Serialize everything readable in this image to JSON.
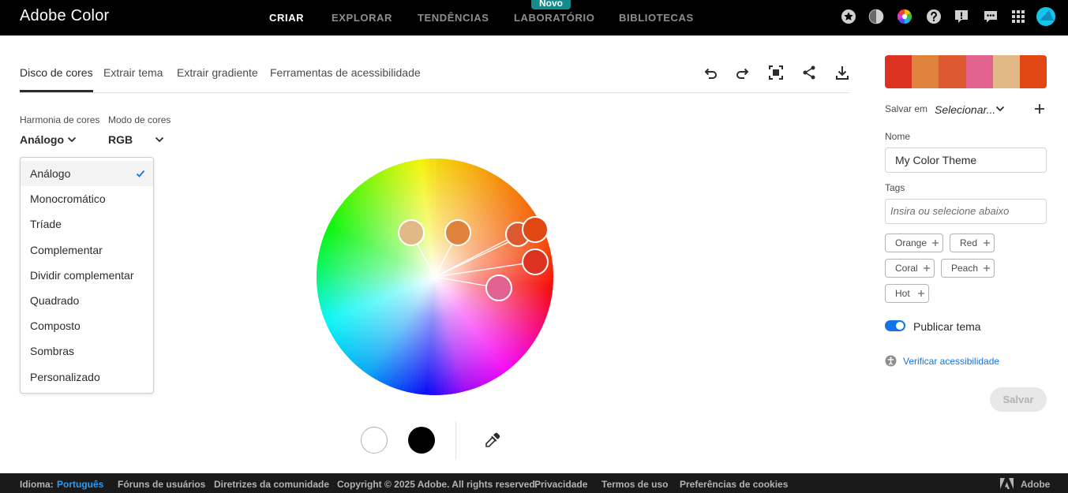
{
  "app": {
    "title": "Adobe Color"
  },
  "nav": {
    "items": [
      "CRIAR",
      "EXPLORAR",
      "TENDÊNCIAS",
      "LABORATÓRIO",
      "BIBLIOTECAS"
    ],
    "active": "CRIAR",
    "badge": "Novo"
  },
  "top_icons": [
    "star-icon",
    "contrast-icon",
    "color-wheel-icon",
    "help-icon",
    "feedback-icon",
    "chat-icon",
    "app-grid-icon"
  ],
  "tabs": [
    "Disco de cores",
    "Extrair tema",
    "Extrair gradiente",
    "Ferramentas de acessibilidade"
  ],
  "toolbar_icons": [
    "undo-icon",
    "redo-icon",
    "fullscreen-icon",
    "share-icon",
    "download-icon"
  ],
  "harmony": {
    "label": "Harmonia de cores",
    "value": "Análogo"
  },
  "mode": {
    "label": "Modo de cores",
    "value": "RGB"
  },
  "harmony_menu": {
    "items": [
      "Análogo",
      "Monocromático",
      "Tríade",
      "Complementar",
      "Dividir complementar",
      "Quadrado",
      "Composto",
      "Sombras",
      "Personalizado"
    ],
    "selected": "Análogo"
  },
  "theme_colors": [
    "#DC3222",
    "#DF833C",
    "#DD5A30",
    "#E2628F",
    "#E0B986",
    "#E04713"
  ],
  "right_panel": {
    "save_in_label": "Salvar em",
    "save_in_value": "Selecionar...",
    "name_label": "Nome",
    "name_value": "My Color Theme",
    "tags_label": "Tags",
    "tags_placeholder": "Insira ou selecione abaixo",
    "tags": [
      "Orange",
      "Red",
      "Coral",
      "Peach",
      "Hot"
    ],
    "publish_label": "Publicar tema",
    "publish_on": true,
    "a11y_link": "Verificar acessibilidade",
    "save_button": "Salvar"
  },
  "footer": {
    "language_label": "Idioma:",
    "language_value": "Português",
    "links": [
      "Fóruns de usuários",
      "Diretrizes da comunidade",
      "Copyright © 2025 Adobe. All rights reserved.",
      "Privacidade",
      "Termos de uso",
      "Preferências de cookies"
    ],
    "brand": "Adobe"
  }
}
